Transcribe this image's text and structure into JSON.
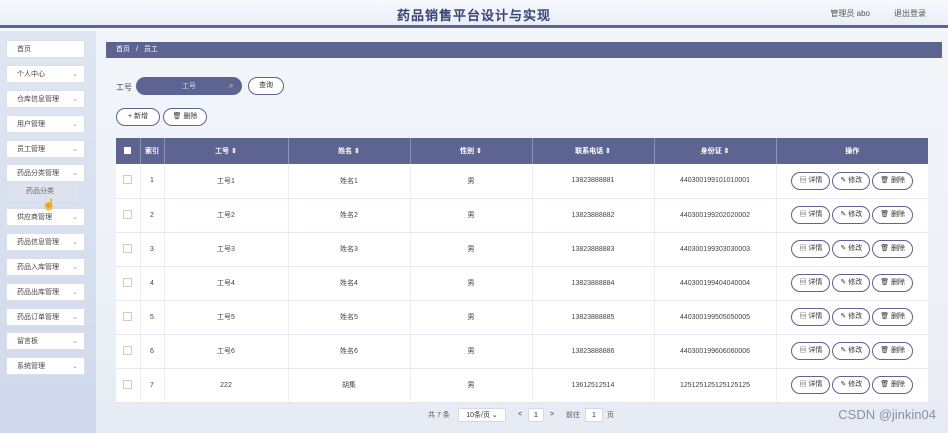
{
  "header": {
    "title": "药品销售平台设计与实现",
    "user": "管理员 abo",
    "logout": "退出登录"
  },
  "sidebar": {
    "items": [
      {
        "label": "首页",
        "chevron": false
      },
      {
        "label": "个人中心",
        "chevron": true
      },
      {
        "label": "仓库信息管理",
        "chevron": true
      },
      {
        "label": "用户管理",
        "chevron": true
      },
      {
        "label": "员工管理",
        "chevron": true
      },
      {
        "label": "药品分类管理",
        "chevron": true
      },
      {
        "label": "供应商管理",
        "chevron": true
      },
      {
        "label": "药品信息管理",
        "chevron": true
      },
      {
        "label": "药品入库管理",
        "chevron": true
      },
      {
        "label": "药品出库管理",
        "chevron": true
      },
      {
        "label": "药品订单管理",
        "chevron": true
      },
      {
        "label": "留言板",
        "chevron": true
      },
      {
        "label": "系统管理",
        "chevron": true
      }
    ],
    "submenu": {
      "label": "药品分类"
    }
  },
  "breadcrumb": {
    "home": "首页",
    "sep": "/",
    "current": "员工"
  },
  "search": {
    "label": "工号",
    "placeholder": "工号",
    "button": "查询"
  },
  "toolbar": {
    "add": "+ 新增",
    "delete": "删除"
  },
  "table": {
    "headers": [
      "索引",
      "工号 ⇕",
      "姓名 ⇕",
      "性别 ⇕",
      "联系电话 ⇕",
      "身份证 ⇕",
      "操作"
    ],
    "rows": [
      {
        "idx": "1",
        "id": "工号1",
        "name": "姓名1",
        "sex": "男",
        "phone": "13823888881",
        "card": "440300199101010001"
      },
      {
        "idx": "2",
        "id": "工号2",
        "name": "姓名2",
        "sex": "男",
        "phone": "13823888882",
        "card": "440300199202020002"
      },
      {
        "idx": "3",
        "id": "工号3",
        "name": "姓名3",
        "sex": "男",
        "phone": "13823888883",
        "card": "440300199303030003"
      },
      {
        "idx": "4",
        "id": "工号4",
        "name": "姓名4",
        "sex": "男",
        "phone": "13823888884",
        "card": "440300199404040004"
      },
      {
        "idx": "5",
        "id": "工号5",
        "name": "姓名5",
        "sex": "男",
        "phone": "13823888885",
        "card": "440300199505050005"
      },
      {
        "idx": "6",
        "id": "工号6",
        "name": "姓名6",
        "sex": "男",
        "phone": "13823888886",
        "card": "440300199606060006"
      },
      {
        "idx": "7",
        "id": "222",
        "name": "胡集",
        "sex": "男",
        "phone": "13612512514",
        "card": "125125125125125125"
      }
    ],
    "actions": {
      "detail": "详情",
      "edit": "修改",
      "delete": "删除"
    }
  },
  "pagination": {
    "total": "共 7 条",
    "page_size": "10条/页",
    "prev": "<",
    "page": "1",
    "next": ">",
    "goto": "前往",
    "goto_value": "1",
    "page_unit": "页"
  },
  "watermark": "CSDN @jinkin04",
  "colors": {
    "accent": "#5d6491"
  }
}
